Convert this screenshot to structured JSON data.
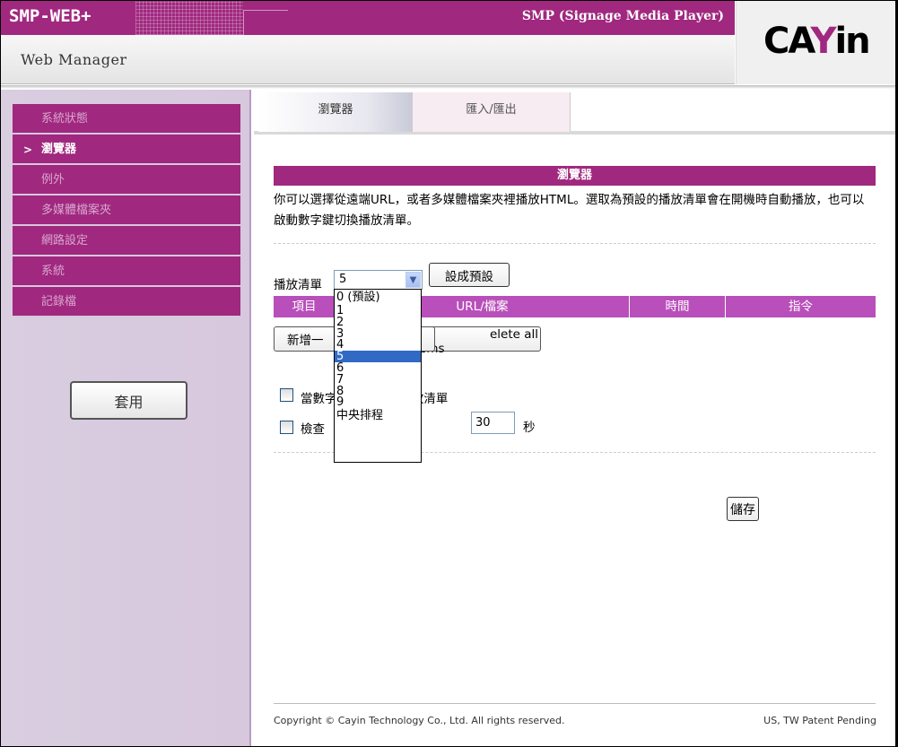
{
  "header": {
    "logo_text": "SMP-WEB+",
    "product_title": "SMP (Signage Media Player)",
    "app_name": "Web Manager",
    "brand_logo_pre": "CA",
    "brand_logo_y": "Y",
    "brand_logo_post": "in",
    "accent_color": "#a0287f"
  },
  "sidebar": {
    "items": [
      {
        "label": "系統狀態",
        "active": false
      },
      {
        "label": "瀏覽器",
        "active": true,
        "marker": ">"
      },
      {
        "label": "例外",
        "active": false
      },
      {
        "label": "多媒體檔案夾",
        "active": false
      },
      {
        "label": "網路設定",
        "active": false
      },
      {
        "label": "系統",
        "active": false
      },
      {
        "label": "記錄檔",
        "active": false
      }
    ],
    "apply_label": "套用"
  },
  "tabs": [
    {
      "label": "瀏覽器",
      "selected": true
    },
    {
      "label": "匯入/匯出",
      "selected": false
    }
  ],
  "main": {
    "section_title": "瀏覽器",
    "description": "你可以選擇從遠端URL，或者多媒體檔案夾裡播放HTML。選取為預設的播放清單會在開機時自動播放，也可以啟動數字鍵切換播放清單。",
    "playlist_label": "播放清單",
    "playlist_selected": "5",
    "set_default_label": "設成預設",
    "table_headers": [
      "項目",
      "URL/檔案",
      "時間",
      "指令"
    ],
    "add_label": "新增一",
    "delete_all_label": "elete all items",
    "checkbox1_label": "當數字鍵          換播放清單",
    "checkbox2_label": "檢查          的間隔",
    "interval_value": "30",
    "seconds_label": "秒",
    "save_label": "儲存",
    "dropdown_options": [
      "0 (預設)",
      "1",
      "2",
      "3",
      "4",
      "5",
      "6",
      "7",
      "8",
      "9",
      "中央排程"
    ],
    "dropdown_selected_index": 5
  },
  "footer": {
    "copyright": "Copyright © Cayin Technology Co., Ltd. All rights reserved.",
    "patent": "US, TW Patent Pending"
  }
}
